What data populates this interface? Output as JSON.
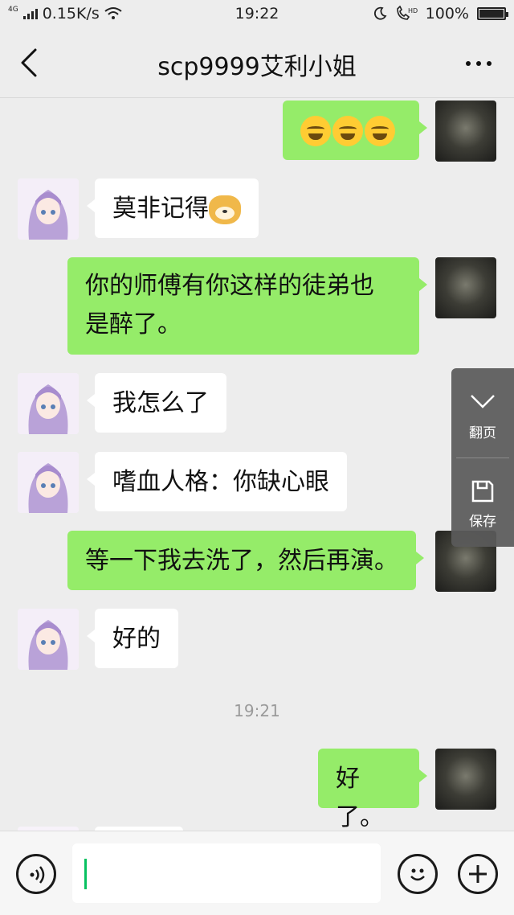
{
  "status_bar": {
    "network_type": "4G",
    "speed": "0.15K/s",
    "time": "19:22",
    "battery": "100%",
    "battery_level": 1.0
  },
  "nav": {
    "title": "scp9999艾利小姐"
  },
  "messages": [
    {
      "from": "me",
      "text": "",
      "emoji": [
        "laugh-cry-emoji",
        "laugh-cry-emoji",
        "laugh-cry-emoji"
      ]
    },
    {
      "from": "her",
      "text": "莫非记得",
      "emoji": [
        "doge-emoji"
      ]
    },
    {
      "from": "me",
      "lines": [
        "你的师傅有你这样的徒弟也",
        "是醉了。"
      ]
    },
    {
      "from": "her",
      "text": "我怎么了"
    },
    {
      "from": "her",
      "text": "嗜血人格：你缺心眼"
    },
    {
      "from": "me",
      "text": "等一下我去洗了，然后再演。"
    },
    {
      "from": "her",
      "text": "好的"
    },
    {
      "from": "me",
      "text": "好了。"
    }
  ],
  "timestamp": "19:21",
  "float_panel": {
    "page_label": "翻页",
    "save_label": "保存"
  },
  "input_bar": {
    "value": ""
  },
  "colors": {
    "background": "#ededed",
    "my_bubble": "#95ec69",
    "her_bubble": "#ffffff",
    "cursor": "#07c160"
  }
}
